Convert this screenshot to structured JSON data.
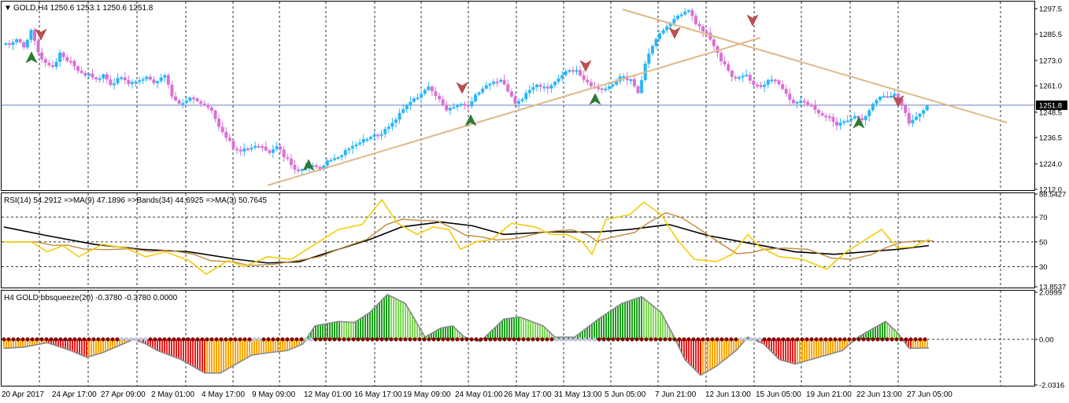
{
  "colors": {
    "bull": "#29b6f6",
    "bear": "#da70d6",
    "trend": "#dfb98b",
    "rsi": "#f2cc0c",
    "rsi_ma": "#c08a3c",
    "rsi_slow": "#000000",
    "sq_green": "#1a9e1a",
    "sq_red": "#ee1c1c",
    "sq_orange": "#ffa500",
    "sq_dot": "#8b0000",
    "price_line": "#6f7fbf"
  },
  "main": {
    "header": "GOLD,H4  1250.6 1253.1 1250.6 1251.8",
    "price_ticks": [
      "1297.5",
      "1285.5",
      "1273.0",
      "1261.0",
      "1248.5",
      "1236.5",
      "1224.0",
      "1212.0"
    ],
    "current_price": "1251.8"
  },
  "rsi": {
    "header": "RSI(14) 54.2912  =>MA(9) 47.1896  =>Bands(34) 44.6925  =>MA(3) 50.7645",
    "ticks": [
      "88.5427",
      "70",
      "50",
      "30",
      "13.8537"
    ]
  },
  "squeeze": {
    "header": "H4 GOLD bbsqueeze(20) -0.3780 -0.3780 0.0000",
    "ticks": [
      "2.0999",
      "0.00",
      "-2.0316"
    ]
  },
  "time_axis": [
    "20 Apr 2017",
    "24 Apr 17:00",
    "27 Apr 09:00",
    "2 May 01:00",
    "4 May 17:00",
    "9 May 09:00",
    "12 May 01:00",
    "16 May 17:00",
    "19 May 09:00",
    "24 May 01:00",
    "26 May 17:00",
    "31 May 13:00",
    "5 Jun 05:00",
    "7 Jun 21:00",
    "12 Jun 13:00",
    "15 Jun 05:00",
    "19 Jun 21:00",
    "22 Jun 13:00",
    "27 Jun 05:00"
  ],
  "chart_data": [
    {
      "type": "candlestick",
      "title": "GOLD,H4",
      "ohlc_last": {
        "open": 1250.6,
        "high": 1253.1,
        "low": 1250.6,
        "close": 1251.8
      },
      "ylim": [
        1212.0,
        1297.5
      ],
      "closes": [
        1281,
        1283,
        1279,
        1287,
        1274,
        1270,
        1276,
        1272,
        1268,
        1266,
        1264,
        1266,
        1262,
        1265,
        1262,
        1264,
        1266,
        1262,
        1266,
        1256,
        1253,
        1255,
        1252,
        1250,
        1242,
        1236,
        1232,
        1230,
        1231,
        1233,
        1230,
        1232,
        1226,
        1222,
        1221,
        1224,
        1222,
        1226,
        1228,
        1232,
        1234,
        1236,
        1238,
        1240,
        1244,
        1248,
        1252,
        1256,
        1260,
        1254,
        1249,
        1251,
        1252,
        1258,
        1262,
        1264,
        1258,
        1253,
        1255,
        1259,
        1262,
        1260,
        1264,
        1268,
        1269,
        1264,
        1261,
        1259,
        1262,
        1266,
        1264,
        1258,
        1276,
        1285,
        1291,
        1294,
        1297,
        1290,
        1286,
        1279,
        1271,
        1264,
        1266,
        1262,
        1260,
        1264,
        1262,
        1258,
        1252,
        1254,
        1252,
        1248,
        1246,
        1243,
        1245,
        1247,
        1244,
        1252,
        1256,
        1257,
        1252,
        1243,
        1246,
        1250,
        1251.8
      ],
      "series": [
        {
          "name": "RSI(14)",
          "last": 54.2912
        },
        {
          "name": "MA(9)",
          "last": 47.1896
        },
        {
          "name": "Bands(34)",
          "last": 44.6925
        },
        {
          "name": "MA(3)",
          "last": 50.7645
        }
      ],
      "bbsqueeze_last": -0.378,
      "xlabel": "",
      "ylabel": ""
    }
  ]
}
